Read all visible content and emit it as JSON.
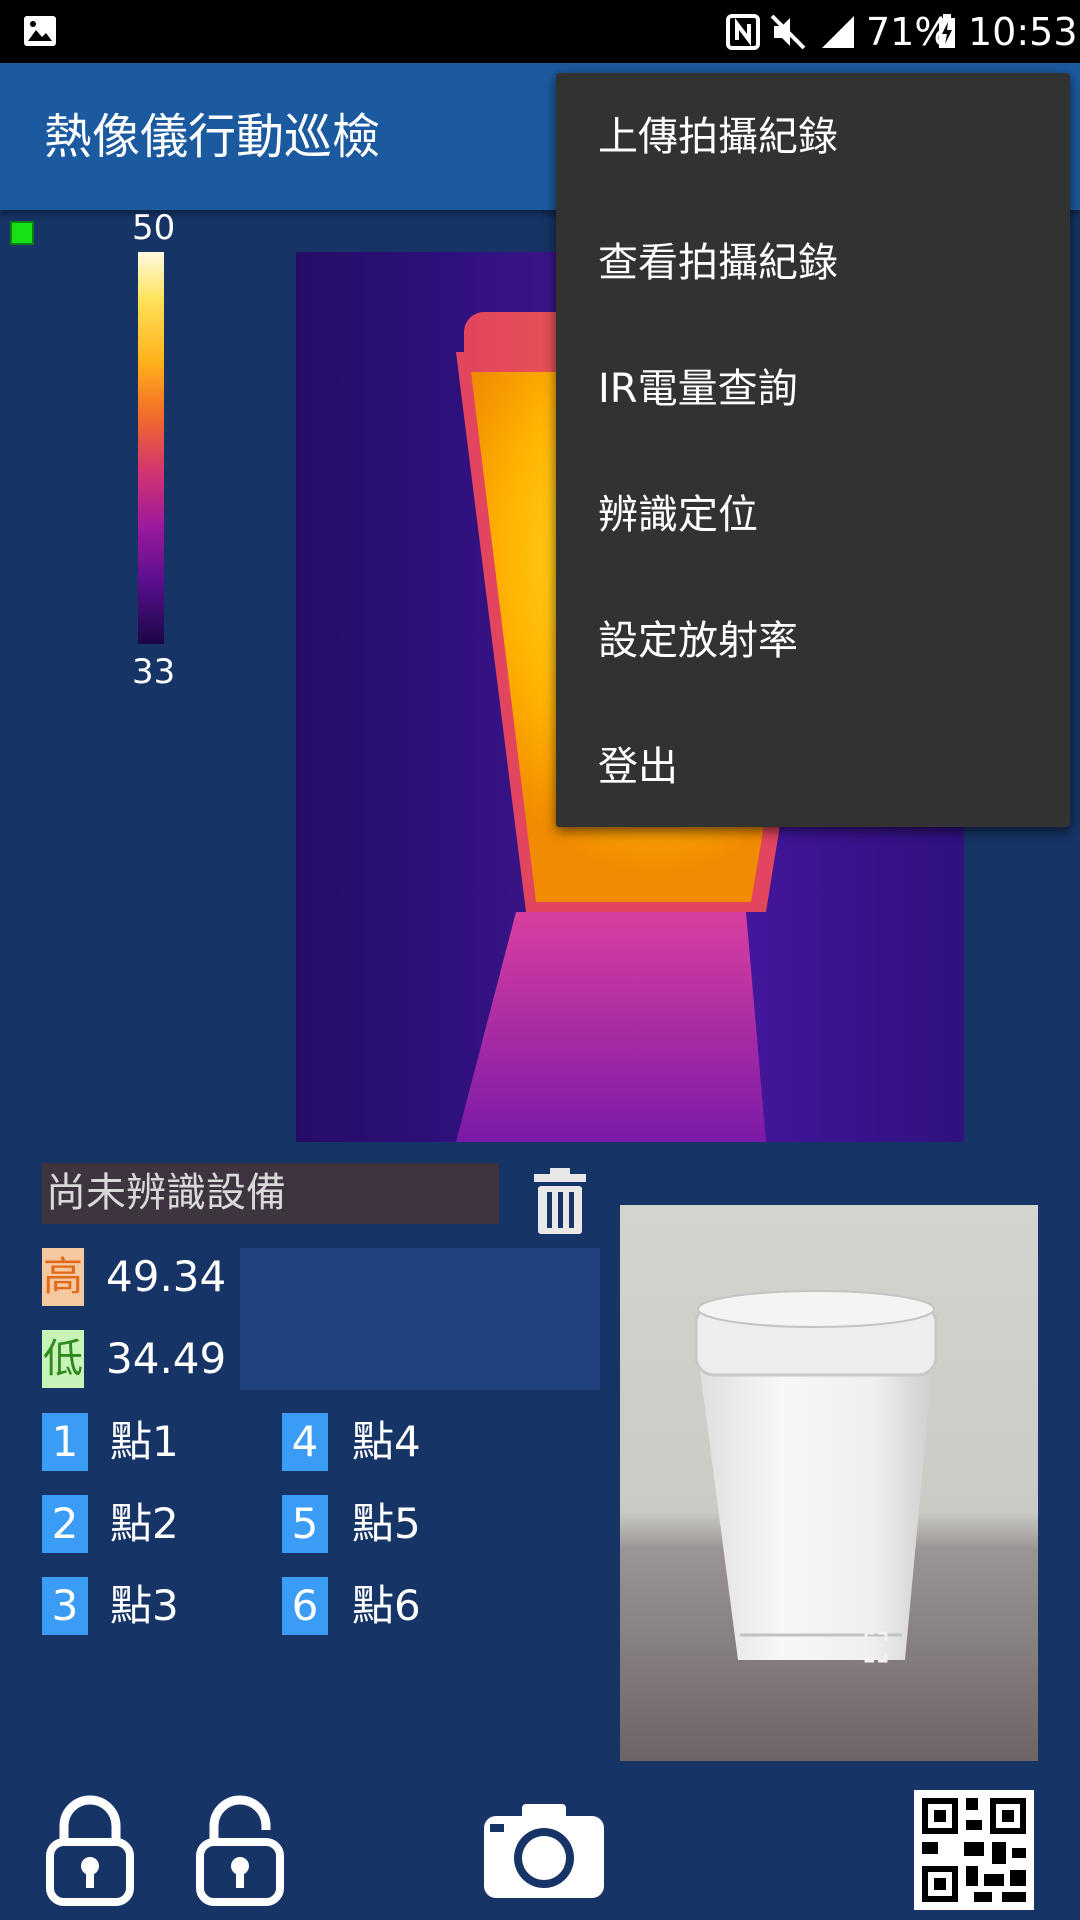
{
  "status_bar": {
    "battery": "71%",
    "time": "10:53",
    "icons": [
      "image-icon",
      "nfc-icon",
      "mute-icon",
      "signal-icon",
      "battery-icon"
    ]
  },
  "app_bar": {
    "title": "熱像儀行動巡檢"
  },
  "overflow_menu": {
    "items": [
      "上傳拍攝紀錄",
      "查看拍攝紀錄",
      "IR電量查詢",
      "辨識定位",
      "設定放射率",
      "登出"
    ]
  },
  "color_scale": {
    "max": "50",
    "min": "33"
  },
  "device": {
    "status": "尚未辨識設備"
  },
  "temperatures": {
    "high_label": "高",
    "high_value": "49.34",
    "low_label": "低",
    "low_value": "34.49"
  },
  "points": [
    {
      "num": "1",
      "label": "點1"
    },
    {
      "num": "2",
      "label": "點2"
    },
    {
      "num": "3",
      "label": "點3"
    },
    {
      "num": "4",
      "label": "點4"
    },
    {
      "num": "5",
      "label": "點5"
    },
    {
      "num": "6",
      "label": "點6"
    }
  ],
  "toolbar": {
    "icons": [
      "lock-icon",
      "unlock-icon",
      "camera-icon",
      "qr-code-icon",
      "trash-icon"
    ]
  },
  "colors": {
    "background": "#163466",
    "app_bar": "#1c5aa0",
    "menu": "#323232",
    "point_badge": "#3a9cf5",
    "high_badge": "#f6c8a0",
    "low_badge": "#c8f4b8"
  }
}
